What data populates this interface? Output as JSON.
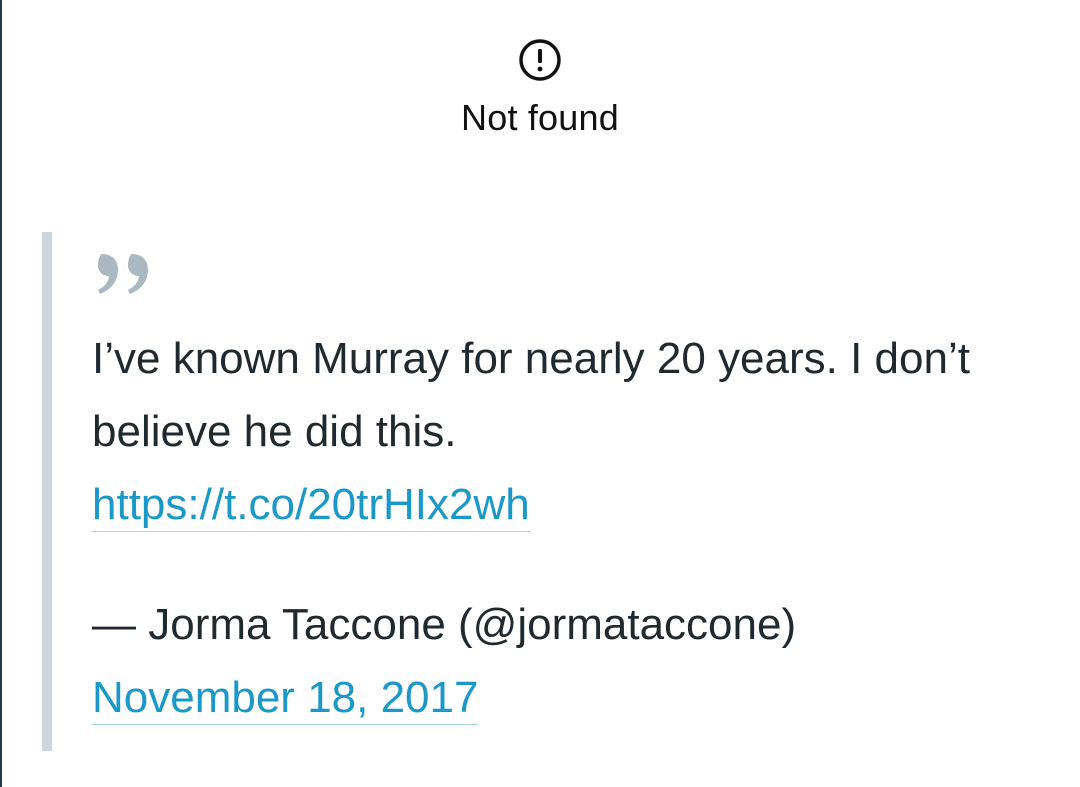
{
  "error": {
    "icon": "exclamation-circle-icon",
    "message": "Not found"
  },
  "tweet": {
    "text": "I’ve known Murray for nearly 20 years. I don’t believe he did this.",
    "link": "https://t.co/20trHIx2wh",
    "attribution": "— Jorma Taccone (@jormataccone)",
    "date": "November 18, 2017"
  },
  "colors": {
    "text": "#1e2a30",
    "link": "#1a98c7",
    "quote_bar": "#ccd6dd",
    "quote_mark": "#aab8c2"
  }
}
